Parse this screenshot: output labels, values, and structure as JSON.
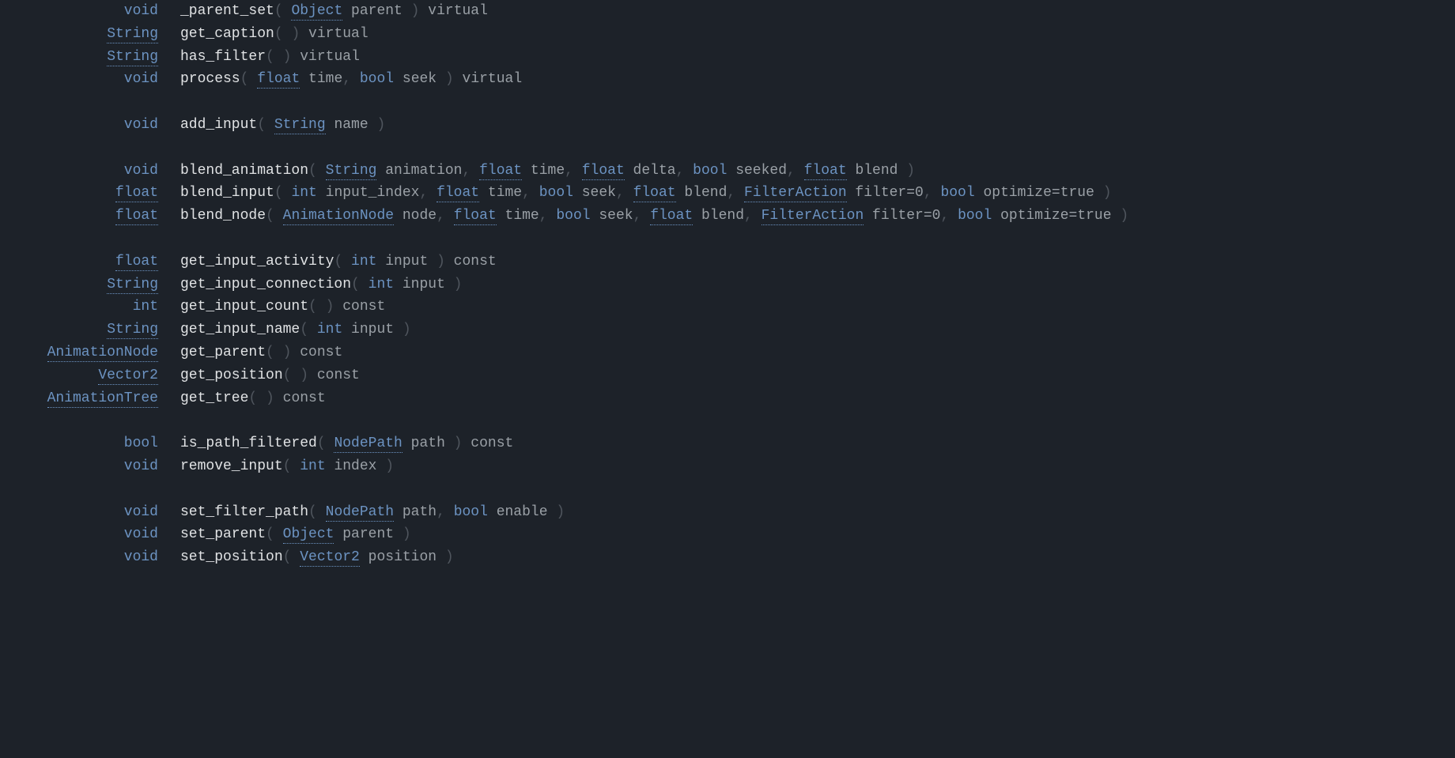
{
  "methods": [
    {
      "ret": {
        "text": "void",
        "link": false
      },
      "name": "_parent_set",
      "params": [
        {
          "type": {
            "text": "Object",
            "link": true
          },
          "name": "parent"
        }
      ],
      "qual": "virtual"
    },
    {
      "ret": {
        "text": "String",
        "link": true
      },
      "name": "get_caption",
      "params": [],
      "qual": "virtual"
    },
    {
      "ret": {
        "text": "String",
        "link": true
      },
      "name": "has_filter",
      "params": [],
      "qual": "virtual"
    },
    {
      "ret": {
        "text": "void",
        "link": false
      },
      "name": "process",
      "params": [
        {
          "type": {
            "text": "float",
            "link": true
          },
          "name": "time"
        },
        {
          "type": {
            "text": "bool",
            "link": false
          },
          "name": "seek"
        }
      ],
      "qual": "virtual"
    },
    {
      "spacer": true
    },
    {
      "ret": {
        "text": "void",
        "link": false
      },
      "name": "add_input",
      "params": [
        {
          "type": {
            "text": "String",
            "link": true
          },
          "name": "name"
        }
      ],
      "qual": ""
    },
    {
      "spacer": true
    },
    {
      "ret": {
        "text": "void",
        "link": false
      },
      "name": "blend_animation",
      "params": [
        {
          "type": {
            "text": "String",
            "link": true
          },
          "name": "animation"
        },
        {
          "type": {
            "text": "float",
            "link": true
          },
          "name": "time"
        },
        {
          "type": {
            "text": "float",
            "link": true
          },
          "name": "delta"
        },
        {
          "type": {
            "text": "bool",
            "link": false
          },
          "name": "seeked"
        },
        {
          "type": {
            "text": "float",
            "link": true
          },
          "name": "blend"
        }
      ],
      "qual": ""
    },
    {
      "ret": {
        "text": "float",
        "link": true
      },
      "name": "blend_input",
      "params": [
        {
          "type": {
            "text": "int",
            "link": false
          },
          "name": "input_index"
        },
        {
          "type": {
            "text": "float",
            "link": true
          },
          "name": "time"
        },
        {
          "type": {
            "text": "bool",
            "link": false
          },
          "name": "seek"
        },
        {
          "type": {
            "text": "float",
            "link": true
          },
          "name": "blend"
        },
        {
          "type": {
            "text": "FilterAction",
            "link": true
          },
          "name": "filter=0"
        },
        {
          "type": {
            "text": "bool",
            "link": false
          },
          "name": "optimize=true"
        }
      ],
      "qual": ""
    },
    {
      "ret": {
        "text": "float",
        "link": true
      },
      "name": "blend_node",
      "params": [
        {
          "type": {
            "text": "AnimationNode",
            "link": true
          },
          "name": "node"
        },
        {
          "type": {
            "text": "float",
            "link": true
          },
          "name": "time"
        },
        {
          "type": {
            "text": "bool",
            "link": false
          },
          "name": "seek"
        },
        {
          "type": {
            "text": "float",
            "link": true
          },
          "name": "blend"
        },
        {
          "type": {
            "text": "FilterAction",
            "link": true
          },
          "name": "filter=0"
        },
        {
          "type": {
            "text": "bool",
            "link": false
          },
          "name": "optimize=true"
        }
      ],
      "qual": ""
    },
    {
      "spacer": true
    },
    {
      "ret": {
        "text": "float",
        "link": true
      },
      "name": "get_input_activity",
      "params": [
        {
          "type": {
            "text": "int",
            "link": false
          },
          "name": "input"
        }
      ],
      "qual": "const"
    },
    {
      "ret": {
        "text": "String",
        "link": true
      },
      "name": "get_input_connection",
      "params": [
        {
          "type": {
            "text": "int",
            "link": false
          },
          "name": "input"
        }
      ],
      "qual": ""
    },
    {
      "ret": {
        "text": "int",
        "link": false
      },
      "name": "get_input_count",
      "params": [],
      "qual": "const"
    },
    {
      "ret": {
        "text": "String",
        "link": true
      },
      "name": "get_input_name",
      "params": [
        {
          "type": {
            "text": "int",
            "link": false
          },
          "name": "input"
        }
      ],
      "qual": ""
    },
    {
      "ret": {
        "text": "AnimationNode",
        "link": true
      },
      "name": "get_parent",
      "params": [],
      "qual": "const"
    },
    {
      "ret": {
        "text": "Vector2",
        "link": true
      },
      "name": "get_position",
      "params": [],
      "qual": "const"
    },
    {
      "ret": {
        "text": "AnimationTree",
        "link": true
      },
      "name": "get_tree",
      "params": [],
      "qual": "const"
    },
    {
      "spacer": true
    },
    {
      "ret": {
        "text": "bool",
        "link": false
      },
      "name": "is_path_filtered",
      "params": [
        {
          "type": {
            "text": "NodePath",
            "link": true
          },
          "name": "path"
        }
      ],
      "qual": "const"
    },
    {
      "ret": {
        "text": "void",
        "link": false
      },
      "name": "remove_input",
      "params": [
        {
          "type": {
            "text": "int",
            "link": false
          },
          "name": "index"
        }
      ],
      "qual": ""
    },
    {
      "spacer": true
    },
    {
      "ret": {
        "text": "void",
        "link": false
      },
      "name": "set_filter_path",
      "params": [
        {
          "type": {
            "text": "NodePath",
            "link": true
          },
          "name": "path"
        },
        {
          "type": {
            "text": "bool",
            "link": false
          },
          "name": "enable"
        }
      ],
      "qual": ""
    },
    {
      "ret": {
        "text": "void",
        "link": false
      },
      "name": "set_parent",
      "params": [
        {
          "type": {
            "text": "Object",
            "link": true
          },
          "name": "parent"
        }
      ],
      "qual": ""
    },
    {
      "ret": {
        "text": "void",
        "link": false
      },
      "name": "set_position",
      "params": [
        {
          "type": {
            "text": "Vector2",
            "link": true
          },
          "name": "position"
        }
      ],
      "qual": ""
    }
  ]
}
